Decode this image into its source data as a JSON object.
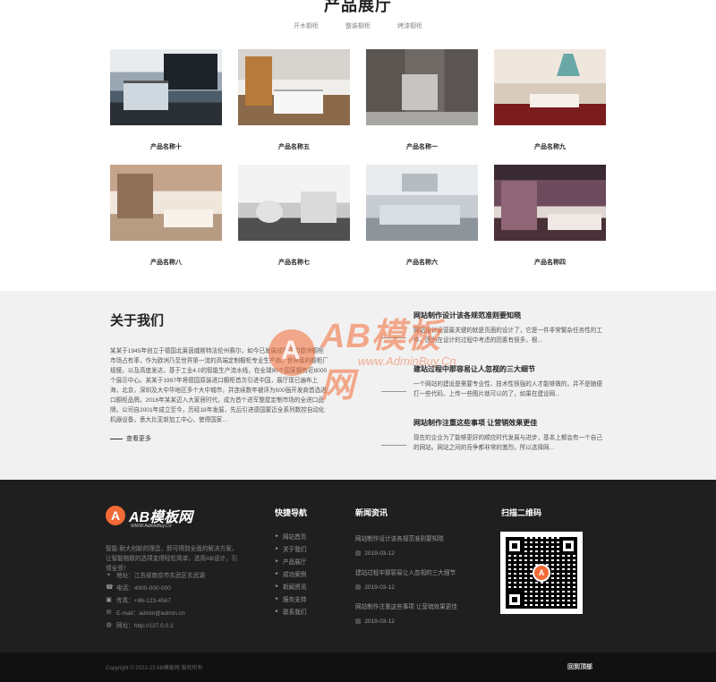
{
  "products": {
    "title": "产品展厅",
    "tabs": [
      "开木橱柜",
      "整装橱柜",
      "烤漆橱柜"
    ],
    "items": [
      {
        "name": "产品名称十"
      },
      {
        "name": "产品名称五"
      },
      {
        "name": "产品名称一"
      },
      {
        "name": "产品名称九"
      },
      {
        "name": "产品名称八"
      },
      {
        "name": "产品名称七"
      },
      {
        "name": "产品名称六"
      },
      {
        "name": "产品名称四"
      }
    ]
  },
  "about": {
    "title": "关于我们",
    "text": "某某于1945年创立于德国北莱茵威斯特法伦州赛尔，如今已发展成德国和欧洲橱柜市场占有率，作为欧洲乃至世界第一流的高端定制橱柜专业生产商，世界级的橱柜厂规模，以及高度发达，基于工业4.0的智能生产流水线，在全球90个国家拥有近8000个展示中心。某某于1997年将德国原装进口橱柜首次引进中国，展厅现已遍布上海，北京，深圳及大中华地区多个大中城市，并连续数年被评为500强开发商首选进口橱柜品牌。2016年某某迈入大家居时代，成为首个进军整屋定制市场的全进口品牌。公司自2001年成立至今，历经18年发展，先后引进德国蒙迈全系列数控自动化机器设备，意大比亚新加工中心，使得国家...",
    "more": "查看更多"
  },
  "news": [
    {
      "title": "网站制作设计该各规范准则要知晓",
      "desc": "网站设计运营最关键的就是页面的设计了，它是一件非常繁杂任务性的工作，因为在设计的过程中考虑的因素有很多，根..."
    },
    {
      "title": "建站过程中那容易让人忽视的三大细节",
      "desc": "一个网站的建设是需要专业性、技术性很强的人才能够做的，并不是随便打一些代码、上传一些图片就可以的了，如果在建设网..."
    },
    {
      "title": "网站制作注重这些事项 让营销效果更佳",
      "desc": "现在的企业为了能够更好的顺应时代发展与进步，基本上都会有一个自己的网站。网站之间的竞争都非常的激烈，所以选择网..."
    }
  ],
  "watermark": {
    "brand": "AB模板网",
    "url": "www.AdminBuy.Cn"
  },
  "footer": {
    "logo_letter": "A",
    "logo_text": "AB模板网",
    "logo_sub": "WWW.AdminBuy.Cn",
    "intro": "智能·耐大创新的理念，即可得到全面的解决方案，让智能物联的选项变得轻松简单，选用AB设计，引领全领！",
    "contacts": [
      {
        "icon": "location-icon",
        "text": "地址：江苏省南京市玄武区玄武湖"
      },
      {
        "icon": "phone-icon",
        "text": "电话：4000-000-000"
      },
      {
        "icon": "fax-icon",
        "text": "传真：+86-123-4567"
      },
      {
        "icon": "email-icon",
        "text": "E-mail：admin@admin.cn"
      },
      {
        "icon": "globe-icon",
        "text": "网址：http://127.0.0.1"
      }
    ],
    "nav_title": "快捷导航",
    "nav": [
      "网站首页",
      "关于我们",
      "产品展厅",
      "成功案例",
      "新闻资讯",
      "服务支持",
      "联系我们"
    ],
    "news_title": "新闻资讯",
    "news": [
      {
        "title": "网站制作设计该各规范准则要知晓",
        "date": "2019-03-12"
      },
      {
        "title": "建站过程中那容易让人忽视的三大细节",
        "date": "2019-03-12"
      },
      {
        "title": "网站制作注重这些事项 让营销效果更佳",
        "date": "2019-03-12"
      }
    ],
    "qr_title": "扫描二维码",
    "qr_letter": "A",
    "copyright": "Copyright © 2022-23 AB模板网 版权所有",
    "back_top": "回到顶部"
  },
  "colors": {
    "accent": "#f26a35",
    "footer_bg": "#1f1f1f",
    "about_bg": "#f1f1f1"
  }
}
